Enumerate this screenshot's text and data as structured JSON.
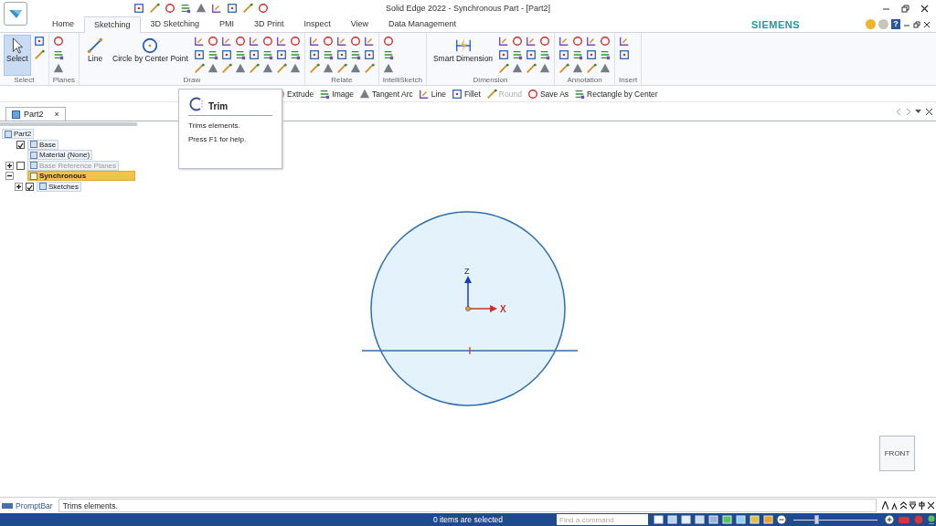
{
  "window": {
    "title": "Solid Edge 2022 - Synchronous Part - [Part2]"
  },
  "tabs": [
    {
      "label": "Home",
      "selected": false
    },
    {
      "label": "Sketching",
      "selected": true
    },
    {
      "label": "3D Sketching",
      "selected": false
    },
    {
      "label": "PMI",
      "selected": false
    },
    {
      "label": "3D Print",
      "selected": false
    },
    {
      "label": "Inspect",
      "selected": false
    },
    {
      "label": "View",
      "selected": false
    },
    {
      "label": "Data Management",
      "selected": false
    }
  ],
  "brand": "SIEMENS",
  "help_label": "?",
  "ribbon": [
    {
      "label": "Select",
      "big": [
        {
          "label": "Select",
          "selected": true
        }
      ]
    },
    {
      "label": "Planes"
    },
    {
      "label": "Draw",
      "big": [
        {
          "label": "Line",
          "selected": false
        },
        {
          "label": "Circle by Center Point",
          "selected": false
        }
      ]
    },
    {
      "label": "Relate"
    },
    {
      "label": "IntelliSketch"
    },
    {
      "label": "Dimension",
      "big": [
        {
          "label": "Smart Dimension",
          "selected": false
        }
      ]
    },
    {
      "label": "Annotation"
    },
    {
      "label": "Insert"
    }
  ],
  "quick_bar": [
    {
      "label": "Extrude",
      "disabled": false
    },
    {
      "label": "Image",
      "disabled": false
    },
    {
      "label": "Tangent Arc",
      "disabled": false
    },
    {
      "label": "Line",
      "disabled": false
    },
    {
      "label": "Fillet",
      "disabled": false
    },
    {
      "label": "Round",
      "disabled": true
    },
    {
      "label": "Save As",
      "disabled": false
    },
    {
      "label": "Rectangle by Center",
      "disabled": false
    }
  ],
  "tooltip": {
    "title": "Trim",
    "description": "Trims elements.",
    "hint": "Press F1 for help."
  },
  "doc_tab": {
    "label": "Part2",
    "close": "×"
  },
  "tree": {
    "label": "Part2",
    "children": [
      {
        "label": "Base",
        "kind": "check",
        "checked": true,
        "selected": false,
        "dimmed": false
      },
      {
        "label": "Material (None)",
        "kind": "plain",
        "selected": false,
        "dimmed": false
      },
      {
        "label": "Base Reference Planes",
        "kind": "check",
        "checked": false,
        "expanded": false,
        "selected": false,
        "dimmed": true
      },
      {
        "label": "Synchronous",
        "kind": "plain",
        "expanded": true,
        "selected": true,
        "dimmed": false,
        "children": [
          {
            "label": "Sketches",
            "kind": "check",
            "checked": true,
            "expanded": false,
            "selected": false,
            "dimmed": false
          }
        ]
      }
    ]
  },
  "canvas": {
    "z_label": "Z",
    "x_label": "X",
    "view_cube": "FRONT"
  },
  "prompt_bar": {
    "label": "PromptBar",
    "message": "Trims elements."
  },
  "status_bar": {
    "selection": "0 items are selected",
    "search": {
      "placeholder": "Find a command"
    },
    "zoom": {
      "level": 0.27
    }
  }
}
